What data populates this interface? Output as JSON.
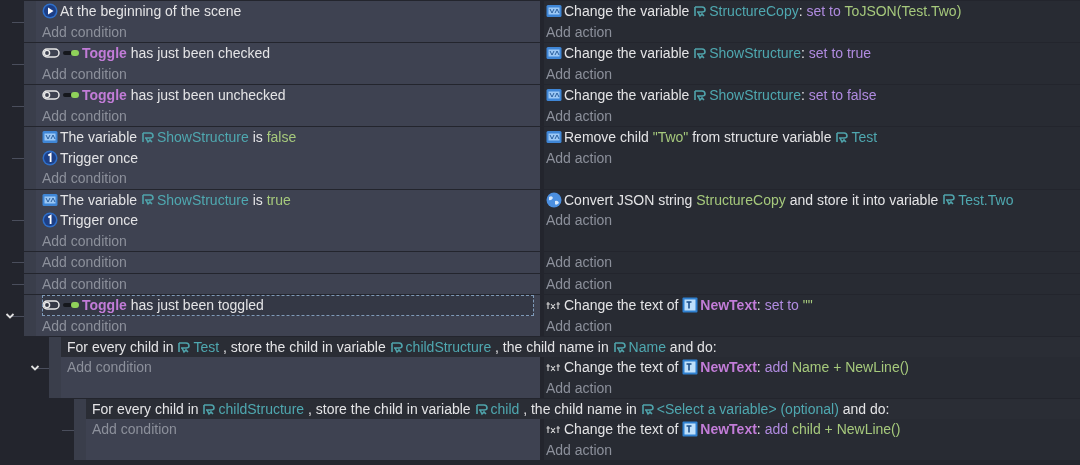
{
  "events": [
    {
      "conditions": [
        {
          "kind": "scene-start",
          "selected": false,
          "parts": [
            {
              "kind": "plain",
              "text": "At the beginning of the scene"
            }
          ]
        }
      ],
      "add_condition": "Add condition",
      "actions": [
        {
          "kind": "variable",
          "selected": false,
          "parts": [
            {
              "kind": "plain",
              "text": "Change the variable "
            },
            {
              "kind": "variable",
              "text": "StructureCopy"
            },
            {
              "kind": "plain",
              "text": ": "
            },
            {
              "kind": "op",
              "text": "set to "
            },
            {
              "kind": "value",
              "text": "ToJSON(Test.Two)"
            }
          ]
        }
      ],
      "add_action": "Add action"
    },
    {
      "conditions": [
        {
          "kind": "toggle",
          "selected": false,
          "parts": [
            {
              "kind": "toggle-object",
              "text": "Toggle"
            },
            {
              "kind": "plain",
              "text": " has just been checked"
            }
          ]
        }
      ],
      "add_condition": "Add condition",
      "actions": [
        {
          "kind": "variable",
          "selected": false,
          "parts": [
            {
              "kind": "plain",
              "text": "Change the variable "
            },
            {
              "kind": "variable",
              "text": "ShowStructure"
            },
            {
              "kind": "plain",
              "text": ": "
            },
            {
              "kind": "op",
              "text": "set to true"
            }
          ]
        }
      ],
      "add_action": "Add action"
    },
    {
      "conditions": [
        {
          "kind": "toggle",
          "selected": false,
          "parts": [
            {
              "kind": "toggle-object",
              "text": "Toggle"
            },
            {
              "kind": "plain",
              "text": " has just been unchecked"
            }
          ]
        }
      ],
      "add_condition": "Add condition",
      "actions": [
        {
          "kind": "variable",
          "selected": false,
          "parts": [
            {
              "kind": "plain",
              "text": "Change the variable "
            },
            {
              "kind": "variable",
              "text": "ShowStructure"
            },
            {
              "kind": "plain",
              "text": ": "
            },
            {
              "kind": "op",
              "text": "set to false"
            }
          ]
        }
      ],
      "add_action": "Add action"
    },
    {
      "conditions": [
        {
          "kind": "variable",
          "selected": false,
          "parts": [
            {
              "kind": "plain",
              "text": "The variable "
            },
            {
              "kind": "variable",
              "text": "ShowStructure"
            },
            {
              "kind": "plain",
              "text": " is "
            },
            {
              "kind": "value",
              "text": "false"
            }
          ]
        },
        {
          "kind": "trigger-once",
          "selected": false,
          "parts": [
            {
              "kind": "plain",
              "text": "Trigger once"
            }
          ]
        }
      ],
      "add_condition": "Add condition",
      "actions": [
        {
          "kind": "variable",
          "selected": false,
          "parts": [
            {
              "kind": "plain",
              "text": "Remove child "
            },
            {
              "kind": "value",
              "text": "\"Two\""
            },
            {
              "kind": "plain",
              "text": " from structure variable "
            },
            {
              "kind": "variable",
              "text": "Test"
            }
          ]
        }
      ],
      "add_action": "Add action"
    },
    {
      "conditions": [
        {
          "kind": "variable",
          "selected": false,
          "parts": [
            {
              "kind": "plain",
              "text": "The variable "
            },
            {
              "kind": "variable",
              "text": "ShowStructure"
            },
            {
              "kind": "plain",
              "text": " is "
            },
            {
              "kind": "value",
              "text": "true"
            }
          ]
        },
        {
          "kind": "trigger-once",
          "selected": false,
          "parts": [
            {
              "kind": "plain",
              "text": "Trigger once"
            }
          ]
        }
      ],
      "add_condition": "Add condition",
      "actions": [
        {
          "kind": "json",
          "selected": false,
          "parts": [
            {
              "kind": "plain",
              "text": "Convert JSON string "
            },
            {
              "kind": "value",
              "text": "StructureCopy"
            },
            {
              "kind": "plain",
              "text": " and store it into variable "
            },
            {
              "kind": "variable",
              "text": "Test.Two"
            }
          ]
        }
      ],
      "add_action": "Add action"
    },
    {
      "add_condition": "Add condition",
      "add_action": "Add action"
    },
    {
      "add_condition": "Add condition",
      "add_action": "Add action"
    },
    {
      "expanded": true,
      "conditions": [
        {
          "kind": "toggle",
          "selected": true,
          "parts": [
            {
              "kind": "toggle-object",
              "text": "Toggle"
            },
            {
              "kind": "plain",
              "text": " has just been toggled"
            }
          ]
        }
      ],
      "add_condition": "Add condition",
      "actions": [
        {
          "kind": "text",
          "selected": false,
          "parts": [
            {
              "kind": "plain",
              "text": "Change the text of "
            },
            {
              "kind": "text-object",
              "text": "NewText"
            },
            {
              "kind": "plain",
              "text": ": "
            },
            {
              "kind": "op",
              "text": "set to "
            },
            {
              "kind": "value",
              "text": "\"\""
            }
          ]
        }
      ],
      "add_action": "Add action",
      "children": [
        {
          "expanded": true,
          "header": [
            {
              "kind": "plain",
              "text": "For every child in "
            },
            {
              "kind": "variable",
              "text": "Test"
            },
            {
              "kind": "plain",
              "text": " , store the child in variable "
            },
            {
              "kind": "variable",
              "text": "childStructure"
            },
            {
              "kind": "plain",
              "text": " , the child name in "
            },
            {
              "kind": "variable",
              "text": "Name"
            },
            {
              "kind": "plain",
              "text": " and do:"
            }
          ],
          "add_condition": "Add condition",
          "actions": [
            {
              "kind": "text",
              "selected": false,
              "parts": [
                {
                  "kind": "plain",
                  "text": "Change the text of "
                },
                {
                  "kind": "text-object",
                  "text": "NewText"
                },
                {
                  "kind": "plain",
                  "text": ": "
                },
                {
                  "kind": "op",
                  "text": "add "
                },
                {
                  "kind": "value",
                  "text": "Name + NewLine()"
                }
              ]
            }
          ],
          "add_action": "Add action",
          "children": [
            {
              "header": [
                {
                  "kind": "plain",
                  "text": "For every child in "
                },
                {
                  "kind": "variable",
                  "text": "childStructure"
                },
                {
                  "kind": "plain",
                  "text": " , store the child in variable "
                },
                {
                  "kind": "variable",
                  "text": "child"
                },
                {
                  "kind": "plain",
                  "text": " , the child name in "
                },
                {
                  "kind": "variable",
                  "text": "<Select a variable> (optional)"
                },
                {
                  "kind": "plain",
                  "text": " and do:"
                }
              ],
              "add_condition": "Add condition",
              "actions": [
                {
                  "kind": "text",
                  "selected": false,
                  "parts": [
                    {
                      "kind": "plain",
                      "text": "Change the text of "
                    },
                    {
                      "kind": "text-object",
                      "text": "NewText"
                    },
                    {
                      "kind": "plain",
                      "text": ": "
                    },
                    {
                      "kind": "op",
                      "text": "add "
                    },
                    {
                      "kind": "value",
                      "text": "child + NewLine()"
                    }
                  ]
                }
              ],
              "add_action": "Add action"
            }
          ]
        }
      ]
    }
  ]
}
